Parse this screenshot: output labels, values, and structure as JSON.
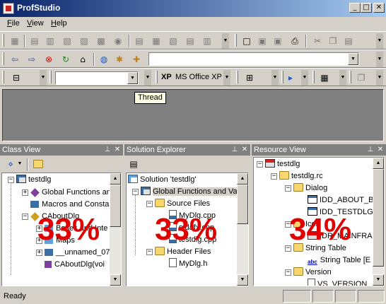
{
  "window": {
    "title": "ProfStudio"
  },
  "menu": [
    "File",
    "View",
    "Help"
  ],
  "toolbar3": {
    "dropdown_value": "",
    "xp_label": "XP",
    "theme_label": "MS Office XP"
  },
  "tooltip": "Thread",
  "panes": {
    "class_view": {
      "title": "Class View",
      "root": "testdlg",
      "items": [
        "Global Functions and",
        "Macros and Consta",
        "CAboutDlg",
        "Bases and Inte",
        "Maps",
        "__unnamed_07",
        "CAboutDlg(voi"
      ],
      "percent": "33%"
    },
    "solution_explorer": {
      "title": "Solution Explorer",
      "items": [
        "Solution 'testdlg'",
        "Global Functions and Va",
        "Source Files",
        "MyDlg.cpp",
        "stdafx.cpp",
        "testdlg.cpp",
        "Header Files",
        "MyDlg.h"
      ],
      "percent": "33%"
    },
    "resource_view": {
      "title": "Resource View",
      "items": [
        "testdlg",
        "testdlg.rc",
        "Dialog",
        "IDD_ABOUT_B",
        "IDD_TESTDLG_",
        "Icon",
        "IDR_MAINFRA",
        "String Table",
        "String Table [E",
        "Version",
        "VS_VERSION"
      ],
      "percent": "34%"
    }
  },
  "status": {
    "text": "Ready"
  },
  "icons": [
    "app-icon",
    "minimize-icon",
    "maximize-icon",
    "close-icon",
    "back-icon",
    "forward-icon",
    "stop-icon",
    "refresh-icon",
    "home-icon",
    "new-file-icon",
    "save-icon",
    "print-icon",
    "cut-icon",
    "copy-icon",
    "paste-icon",
    "pin-icon",
    "play-icon"
  ]
}
